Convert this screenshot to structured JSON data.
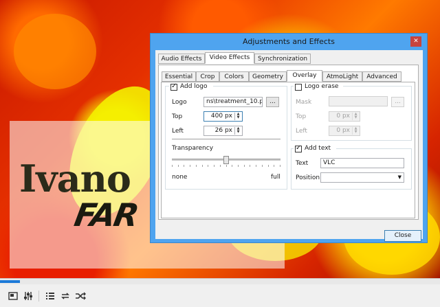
{
  "dialog": {
    "title": "Adjustments and Effects",
    "close_glyph": "✕",
    "main_tabs": [
      "Audio Effects",
      "Video Effects",
      "Synchronization"
    ],
    "active_main_tab": "Video Effects",
    "sub_tabs": [
      "Essential",
      "Crop",
      "Colors",
      "Geometry",
      "Overlay",
      "AtmoLight",
      "Advanced"
    ],
    "active_sub_tab": "Overlay",
    "close_button": "Close"
  },
  "add_logo": {
    "label": "Add logo",
    "checked": true,
    "logo_label": "Logo",
    "logo_value": "ns\\treatment_10.png",
    "browse": "...",
    "top_label": "Top",
    "top_value": "400 px",
    "left_label": "Left",
    "left_value": "26 px",
    "transparency_label": "Transparency",
    "transparency_level": 0.5,
    "slider_min_label": "none",
    "slider_max_label": "full"
  },
  "logo_erase": {
    "label": "Logo erase",
    "checked": false,
    "mask_label": "Mask",
    "mask_value": "",
    "browse": "...",
    "top_label": "Top",
    "top_value": "0 px",
    "left_label": "Left",
    "left_value": "0 px"
  },
  "add_text": {
    "label": "Add text",
    "checked": true,
    "text_label": "Text",
    "text_value": "VLC",
    "position_label": "Position",
    "position_value": ""
  },
  "video_overlay": {
    "logo_line1": "Ivano",
    "logo_line2": "FAR"
  },
  "player": {
    "seek_progress": 0.045,
    "buttons": [
      "fullscreen-icon",
      "extended-settings-icon",
      "playlist-icon",
      "loop-icon",
      "shuffle-icon"
    ]
  },
  "colors": {
    "titlebar": "#4fa4ef",
    "close_red": "#c7443f",
    "seek_blue": "#1c7ad9"
  }
}
